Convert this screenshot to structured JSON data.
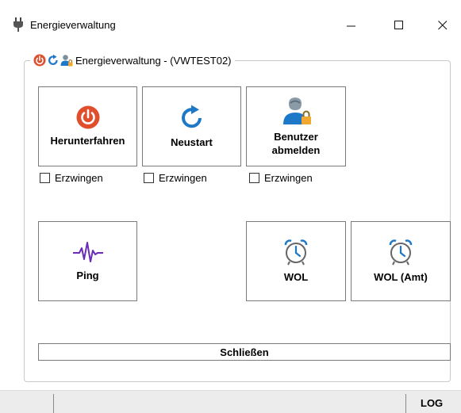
{
  "window": {
    "title": "Energieverwaltung",
    "controls": {
      "minimize": "—",
      "maximize": "☐",
      "close": "✕"
    }
  },
  "group": {
    "title": "Energieverwaltung - (VWTEST02)"
  },
  "actions": {
    "shutdown": {
      "label": "Herunterfahren",
      "icon": "power-icon",
      "color": "#e04e2c"
    },
    "restart": {
      "label": "Neustart",
      "icon": "restart-icon",
      "color": "#1e78c8"
    },
    "logoff": {
      "label_line1": "Benutzer",
      "label_line2": "abmelden",
      "icon": "user-lock-icon"
    },
    "ping": {
      "label": "Ping",
      "icon": "pulse-icon",
      "color": "#6a2bb8"
    },
    "wol": {
      "label": "WOL",
      "icon": "alarm-clock-icon",
      "color": "#1e78c8"
    },
    "wol_amt": {
      "label": "WOL (Amt)",
      "icon": "alarm-clock-icon",
      "color": "#1e78c8"
    }
  },
  "force": {
    "shutdown": {
      "label": "Erzwingen",
      "checked": false
    },
    "restart": {
      "label": "Erzwingen",
      "checked": false
    },
    "logoff": {
      "label": "Erzwingen",
      "checked": false
    }
  },
  "close_label": "Schließen",
  "statusbar": {
    "log_label": "LOG"
  }
}
